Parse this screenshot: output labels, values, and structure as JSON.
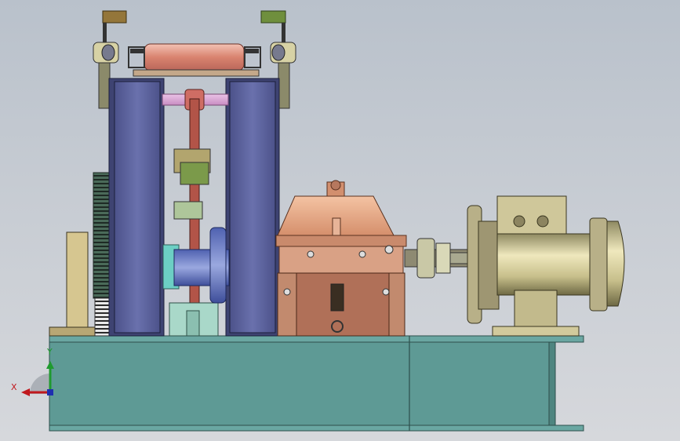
{
  "viewport": {
    "background_top": "#b9c1cb",
    "background_bottom": "#d6d8dc"
  },
  "triad": {
    "x_label": "X",
    "y_label": "Y",
    "x_color": "#c0181d",
    "y_color": "#1f9a2f",
    "z_color": "#1f2fb0"
  },
  "colors": {
    "base_frame": "#5e9a95",
    "side_plate": "#636aa4",
    "roller": "#e09a8a",
    "gearbox": "#e6a98a",
    "motor": "#d8d0a0",
    "pink_shaft": "#e5a6d8",
    "green_bracket": "#6f8f3d",
    "brown_bracket": "#94763a"
  }
}
